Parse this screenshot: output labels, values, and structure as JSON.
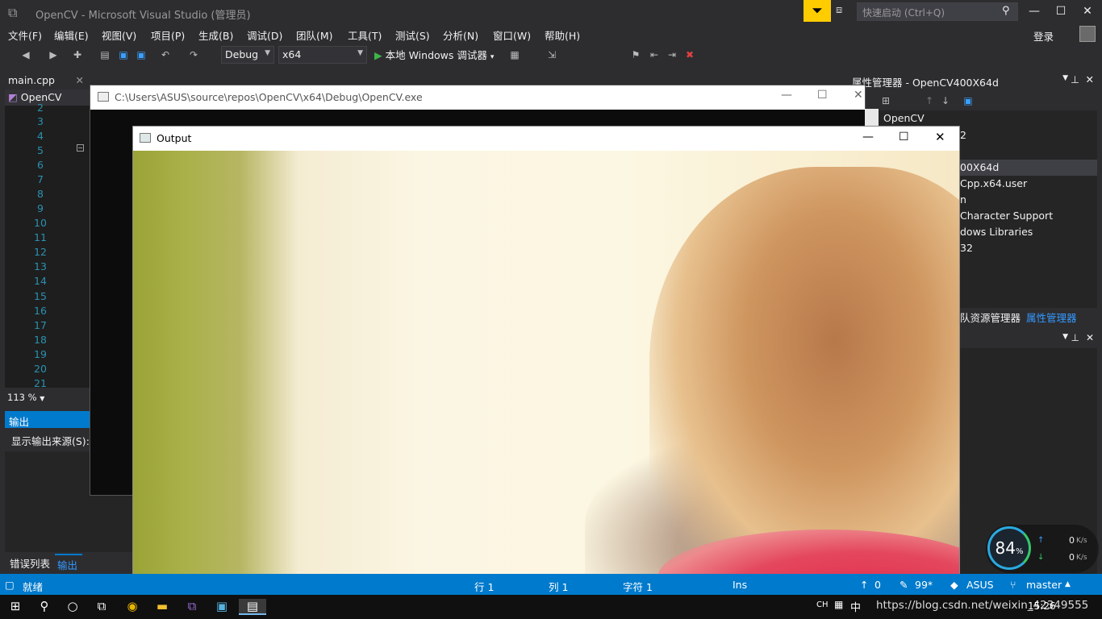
{
  "vs": {
    "title": "OpenCV - Microsoft Visual Studio (管理员)",
    "quicklaunch_placeholder": "快速启动 (Ctrl+Q)",
    "login": "登录",
    "menu": [
      "文件(F)",
      "编辑(E)",
      "视图(V)",
      "项目(P)",
      "生成(B)",
      "调试(D)",
      "团队(M)",
      "工具(T)",
      "测试(S)",
      "分析(N)",
      "窗口(W)",
      "帮助(H)"
    ],
    "config": "Debug",
    "platform": "x64",
    "run_label": "本地 Windows 调试器"
  },
  "editor": {
    "tab": "main.cpp",
    "nav": "OpenCV",
    "zoom": "113 %",
    "line_numbers": [
      "2",
      "3",
      "4",
      "5",
      "6",
      "7",
      "8",
      "9",
      "10",
      "11",
      "12",
      "13",
      "14",
      "15",
      "16",
      "17",
      "18",
      "19",
      "20",
      "21"
    ]
  },
  "output_pane": {
    "header": "输出",
    "source_label": "显示输出来源(S):",
    "tabs": [
      "错误列表",
      "输出"
    ]
  },
  "property_manager": {
    "header": "属性管理器 - OpenCV400X64d",
    "tree": [
      "OpenCV",
      "2",
      "00X64d",
      "Cpp.x64.user",
      "n",
      "Character Support",
      "dows Libraries",
      "32"
    ],
    "tabs": [
      "队资源管理器",
      "属性管理器"
    ]
  },
  "console": {
    "title": "C:\\Users\\ASUS\\source\\repos\\OpenCV\\x64\\Debug\\OpenCV.exe"
  },
  "image_window": {
    "title": "Output"
  },
  "statusbar": {
    "ready": "就绪",
    "row": "行 1",
    "col": "列 1",
    "char": "字符 1",
    "ins": "Ins",
    "up_count": "0",
    "edits": "99*",
    "repo": "ASUS",
    "branch": "master"
  },
  "net_widget": {
    "percent": "84",
    "up": "0",
    "down": "0",
    "unit": "K/s"
  },
  "taskbar": {
    "ime": "CH",
    "lang": "中",
    "time": "15:26",
    "watermark": "https://blog.csdn.net/weixin_42349555"
  }
}
